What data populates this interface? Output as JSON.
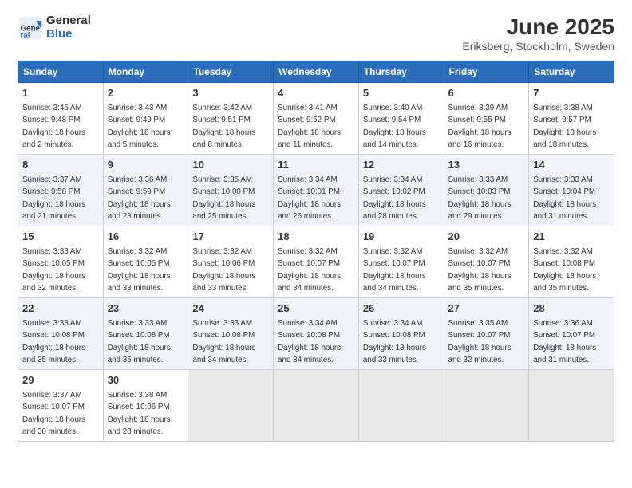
{
  "logo": {
    "general": "General",
    "blue": "Blue"
  },
  "title": "June 2025",
  "subtitle": "Eriksberg, Stockholm, Sweden",
  "days_of_week": [
    "Sunday",
    "Monday",
    "Tuesday",
    "Wednesday",
    "Thursday",
    "Friday",
    "Saturday"
  ],
  "weeks": [
    [
      {
        "day": "1",
        "sunrise": "3:45 AM",
        "sunset": "9:48 PM",
        "daylight": "18 hours and 2 minutes."
      },
      {
        "day": "2",
        "sunrise": "3:43 AM",
        "sunset": "9:49 PM",
        "daylight": "18 hours and 5 minutes."
      },
      {
        "day": "3",
        "sunrise": "3:42 AM",
        "sunset": "9:51 PM",
        "daylight": "18 hours and 8 minutes."
      },
      {
        "day": "4",
        "sunrise": "3:41 AM",
        "sunset": "9:52 PM",
        "daylight": "18 hours and 11 minutes."
      },
      {
        "day": "5",
        "sunrise": "3:40 AM",
        "sunset": "9:54 PM",
        "daylight": "18 hours and 14 minutes."
      },
      {
        "day": "6",
        "sunrise": "3:39 AM",
        "sunset": "9:55 PM",
        "daylight": "18 hours and 16 minutes."
      },
      {
        "day": "7",
        "sunrise": "3:38 AM",
        "sunset": "9:57 PM",
        "daylight": "18 hours and 18 minutes."
      }
    ],
    [
      {
        "day": "8",
        "sunrise": "3:37 AM",
        "sunset": "9:58 PM",
        "daylight": "18 hours and 21 minutes."
      },
      {
        "day": "9",
        "sunrise": "3:36 AM",
        "sunset": "9:59 PM",
        "daylight": "18 hours and 23 minutes."
      },
      {
        "day": "10",
        "sunrise": "3:35 AM",
        "sunset": "10:00 PM",
        "daylight": "18 hours and 25 minutes."
      },
      {
        "day": "11",
        "sunrise": "3:34 AM",
        "sunset": "10:01 PM",
        "daylight": "18 hours and 26 minutes."
      },
      {
        "day": "12",
        "sunrise": "3:34 AM",
        "sunset": "10:02 PM",
        "daylight": "18 hours and 28 minutes."
      },
      {
        "day": "13",
        "sunrise": "3:33 AM",
        "sunset": "10:03 PM",
        "daylight": "18 hours and 29 minutes."
      },
      {
        "day": "14",
        "sunrise": "3:33 AM",
        "sunset": "10:04 PM",
        "daylight": "18 hours and 31 minutes."
      }
    ],
    [
      {
        "day": "15",
        "sunrise": "3:33 AM",
        "sunset": "10:05 PM",
        "daylight": "18 hours and 32 minutes."
      },
      {
        "day": "16",
        "sunrise": "3:32 AM",
        "sunset": "10:05 PM",
        "daylight": "18 hours and 33 minutes."
      },
      {
        "day": "17",
        "sunrise": "3:32 AM",
        "sunset": "10:06 PM",
        "daylight": "18 hours and 33 minutes."
      },
      {
        "day": "18",
        "sunrise": "3:32 AM",
        "sunset": "10:07 PM",
        "daylight": "18 hours and 34 minutes."
      },
      {
        "day": "19",
        "sunrise": "3:32 AM",
        "sunset": "10:07 PM",
        "daylight": "18 hours and 34 minutes."
      },
      {
        "day": "20",
        "sunrise": "3:32 AM",
        "sunset": "10:07 PM",
        "daylight": "18 hours and 35 minutes."
      },
      {
        "day": "21",
        "sunrise": "3:32 AM",
        "sunset": "10:08 PM",
        "daylight": "18 hours and 35 minutes."
      }
    ],
    [
      {
        "day": "22",
        "sunrise": "3:33 AM",
        "sunset": "10:08 PM",
        "daylight": "18 hours and 35 minutes."
      },
      {
        "day": "23",
        "sunrise": "3:33 AM",
        "sunset": "10:08 PM",
        "daylight": "18 hours and 35 minutes."
      },
      {
        "day": "24",
        "sunrise": "3:33 AM",
        "sunset": "10:08 PM",
        "daylight": "18 hours and 34 minutes."
      },
      {
        "day": "25",
        "sunrise": "3:34 AM",
        "sunset": "10:08 PM",
        "daylight": "18 hours and 34 minutes."
      },
      {
        "day": "26",
        "sunrise": "3:34 AM",
        "sunset": "10:08 PM",
        "daylight": "18 hours and 33 minutes."
      },
      {
        "day": "27",
        "sunrise": "3:35 AM",
        "sunset": "10:07 PM",
        "daylight": "18 hours and 32 minutes."
      },
      {
        "day": "28",
        "sunrise": "3:36 AM",
        "sunset": "10:07 PM",
        "daylight": "18 hours and 31 minutes."
      }
    ],
    [
      {
        "day": "29",
        "sunrise": "3:37 AM",
        "sunset": "10:07 PM",
        "daylight": "18 hours and 30 minutes."
      },
      {
        "day": "30",
        "sunrise": "3:38 AM",
        "sunset": "10:06 PM",
        "daylight": "18 hours and 28 minutes."
      },
      null,
      null,
      null,
      null,
      null
    ]
  ],
  "labels": {
    "sunrise": "Sunrise:",
    "sunset": "Sunset:",
    "daylight": "Daylight:"
  }
}
